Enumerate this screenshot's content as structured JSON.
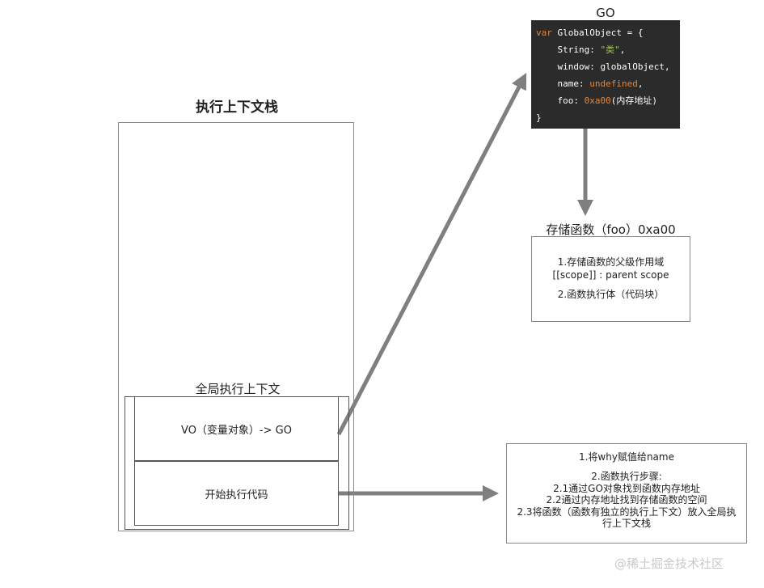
{
  "stack": {
    "title": "执行上下文栈"
  },
  "global_context": {
    "title": "全局执行上下文",
    "vo_label": "VO（变量对象）-> GO",
    "code_label": "开始执行代码"
  },
  "go": {
    "title": "GO",
    "code_lines": {
      "l1_kw": "var",
      "l1_rest": " GlobalObject = {",
      "l2_key": "    String: ",
      "l2_val": "\"类\"",
      "l2_end": ",",
      "l3": "    window: globalObject,",
      "l4_key": "    name: ",
      "l4_val": "undefined",
      "l4_end": ",",
      "l5_key": "    foo: ",
      "l5_val": "0xa00",
      "l5_end": "(内存地址)",
      "l6": "}"
    }
  },
  "function_store": {
    "title": "存储函数（foo）0xa00",
    "line1": "1.存储函数的父级作用域",
    "line2": "[[scope]] : parent scope",
    "line3": "2.函数执行体（代码块）"
  },
  "steps": {
    "line1": "1.将why赋值给name",
    "line2": "2.函数执行步骤:",
    "line3": "2.1通过GO对象找到函数内存地址",
    "line4": "2.2通过内存地址找到存储函数的空间",
    "line5": "2.3将函数（函数有独立的执行上下文）放入全局执",
    "line6": "行上下文栈"
  },
  "watermark": "@稀土掘金技术社区",
  "colors": {
    "arrow": "#7f7f7f",
    "code_bg": "#2b2b2b",
    "code_keyword": "#e0873d",
    "code_string": "#a5c25c"
  }
}
